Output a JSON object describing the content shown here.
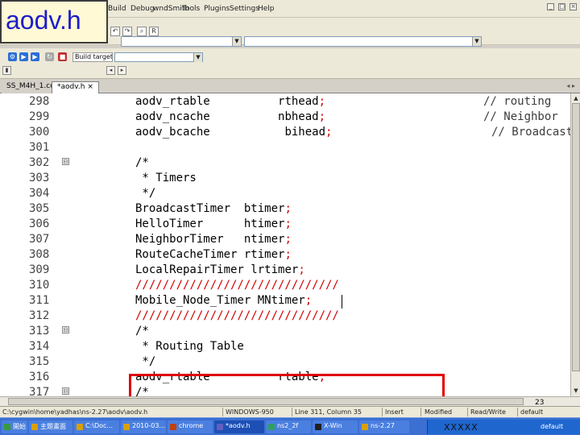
{
  "slide_title": "aodv.h",
  "menu": [
    "Build",
    "Debug",
    "wndSmith",
    "Tools",
    "Plugins",
    "Settings",
    "Help"
  ],
  "window_controls": [
    "_",
    "□",
    "×"
  ],
  "toolbar": {
    "build_target_label": "Build target:",
    "build_target_value": "",
    "search_scope_value": "",
    "search_text_value": ""
  },
  "tabs": [
    {
      "label": "SS_M4H_1.cc",
      "close": ""
    },
    {
      "label": "*aodv.h",
      "close": "×"
    }
  ],
  "tab_nav": "◂ ▸",
  "editor": {
    "lines": [
      {
        "num": "298",
        "fold": "",
        "code": "aodv_rtable",
        "pad": "          ",
        "code2": "rthead",
        "punct": ";",
        "comment": "// routing"
      },
      {
        "num": "299",
        "fold": "",
        "code": "aodv_ncache",
        "pad": "          ",
        "code2": "nbhead",
        "punct": ";",
        "comment": "// Neighbor"
      },
      {
        "num": "300",
        "fold": "",
        "code": "aodv_bcache",
        "pad": "           ",
        "code2": "bihead",
        "punct": ";",
        "comment": "// Broadcast"
      },
      {
        "num": "301",
        "fold": "",
        "code": "",
        "pad": "",
        "code2": "",
        "punct": "",
        "comment": ""
      },
      {
        "num": "302",
        "fold": "⊟",
        "code": "/*",
        "pad": "",
        "code2": "",
        "punct": "",
        "comment": ""
      },
      {
        "num": "303",
        "fold": "",
        "code": " * Timers",
        "pad": "",
        "code2": "",
        "punct": "",
        "comment": ""
      },
      {
        "num": "304",
        "fold": "",
        "code": " */",
        "pad": "",
        "code2": "",
        "punct": "",
        "comment": ""
      },
      {
        "num": "305",
        "fold": "",
        "code": "BroadcastTimer",
        "pad": "  ",
        "code2": "btimer",
        "punct": ";",
        "comment": ""
      },
      {
        "num": "306",
        "fold": "",
        "code": "HelloTimer",
        "pad": "      ",
        "code2": "htimer",
        "punct": ";",
        "comment": ""
      },
      {
        "num": "307",
        "fold": "",
        "code": "NeighborTimer",
        "pad": "   ",
        "code2": "ntimer",
        "punct": ";",
        "comment": ""
      },
      {
        "num": "308",
        "fold": "",
        "code": "RouteCacheTimer",
        "pad": " ",
        "code2": "rtimer",
        "punct": ";",
        "comment": ""
      },
      {
        "num": "309",
        "fold": "",
        "code": "LocalRepairTimer",
        "pad": " ",
        "code2": "lrtimer",
        "punct": ";",
        "comment": ""
      },
      {
        "num": "310",
        "fold": "",
        "code": "",
        "pad": "",
        "code2": "",
        "punct": "//////////////////////////////",
        "comment": ""
      },
      {
        "num": "311",
        "fold": "",
        "code": "Mobile_Node_Timer",
        "pad": " ",
        "code2": "MNtimer",
        "punct": ";",
        "comment": ""
      },
      {
        "num": "312",
        "fold": "",
        "code": "",
        "pad": "",
        "code2": "",
        "punct": "//////////////////////////////",
        "comment": ""
      },
      {
        "num": "313",
        "fold": "⊟",
        "code": "/*",
        "pad": "",
        "code2": "",
        "punct": "",
        "comment": ""
      },
      {
        "num": "314",
        "fold": "",
        "code": " * Routing Table",
        "pad": "",
        "code2": "",
        "punct": "",
        "comment": ""
      },
      {
        "num": "315",
        "fold": "",
        "code": " */",
        "pad": "",
        "code2": "",
        "punct": "",
        "comment": ""
      },
      {
        "num": "316",
        "fold": "",
        "code": "aodv_rtable",
        "pad": "          ",
        "code2": "rtable",
        "punct": ";",
        "comment": ""
      },
      {
        "num": "317",
        "fold": "⊟",
        "code": "/*",
        "pad": "",
        "code2": "",
        "punct": "",
        "comment": ""
      }
    ]
  },
  "page_number": "23",
  "statusbar": {
    "path": "C:\\cygwin\\home\\yadhas\\ns-2.27\\aodv\\aodv.h",
    "eol": "WINDOWS-950",
    "position": "Line 311, Column 35",
    "mode": "Insert",
    "modified": "Modified",
    "access": "Read/Write",
    "profile": "default"
  },
  "taskbar": {
    "tasks": [
      {
        "label": "開始",
        "color": "#3a9a3a"
      },
      {
        "label": "主題畫面",
        "color": "#d9a000"
      },
      {
        "label": "C:\\Doc...",
        "color": "#d9a000"
      },
      {
        "label": "2010-03...",
        "color": "#d9a000"
      },
      {
        "label": "chrome",
        "color": "#c04010"
      },
      {
        "label": "*aodv.h",
        "color": "#6060c0",
        "active": true
      },
      {
        "label": "ns2_2f",
        "color": "#30a060"
      },
      {
        "label": "X-Win",
        "color": "#202020"
      },
      {
        "label": "ns-2.27",
        "color": "#d9a000"
      }
    ],
    "tray_text": "XXXXX",
    "tray_default": "default",
    "clock": ""
  }
}
